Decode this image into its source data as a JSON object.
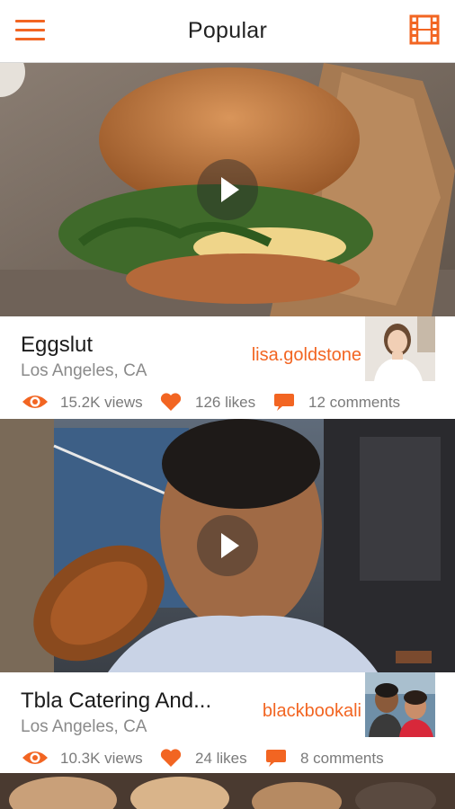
{
  "header": {
    "title": "Popular",
    "menu_icon": "hamburger-menu-icon",
    "video_icon": "film-strip-icon",
    "accent_color": "#f26522"
  },
  "feed": [
    {
      "place_name": "Eggslut",
      "location": "Los Angeles, CA",
      "username": "lisa.goldstone",
      "views": "15.2K views",
      "likes": "126 likes",
      "comments": "12 comments"
    },
    {
      "place_name": "Tbla Catering And...",
      "location": "Los Angeles, CA",
      "username": "blackbookali",
      "views": "10.3K views",
      "likes": "24 likes",
      "comments": "8 comments"
    }
  ]
}
